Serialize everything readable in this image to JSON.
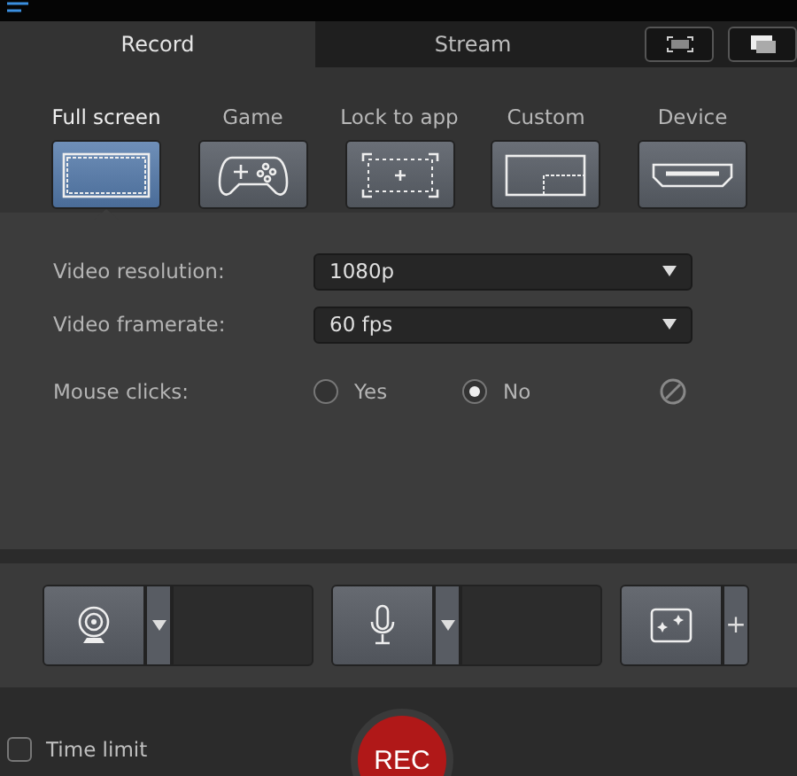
{
  "tabs": [
    {
      "label": "Record",
      "selected": true
    },
    {
      "label": "Stream",
      "selected": false
    }
  ],
  "modes": [
    {
      "kind": "fullscreen",
      "label": "Full screen",
      "selected": true
    },
    {
      "kind": "game",
      "label": "Game",
      "selected": false
    },
    {
      "kind": "lock",
      "label": "Lock to app",
      "selected": false
    },
    {
      "kind": "custom",
      "label": "Custom",
      "selected": false
    },
    {
      "kind": "device",
      "label": "Device",
      "selected": false
    }
  ],
  "settings": [
    {
      "label": "Video resolution:",
      "value": "1080p"
    },
    {
      "label": "Video framerate:",
      "value": "60 fps"
    }
  ],
  "mouse_clicks": {
    "label": "Mouse clicks:",
    "options": [
      {
        "label": "Yes",
        "selected": false
      },
      {
        "label": "No",
        "selected": true
      }
    ]
  },
  "overlays": [
    {
      "kind": "webcam"
    },
    {
      "kind": "microphone"
    }
  ],
  "effects_plus": "+",
  "time_limit": {
    "label": "Time limit",
    "checked": false
  },
  "rec_button": "REC"
}
